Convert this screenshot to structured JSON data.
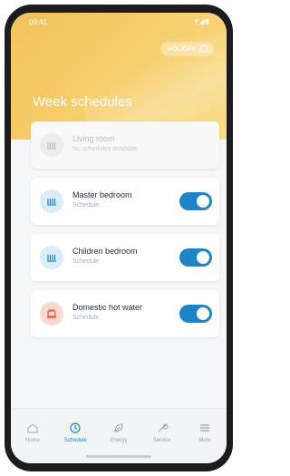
{
  "status_bar": {
    "time": "09:41",
    "icons": "▾◢▮"
  },
  "header": {
    "holiday_label": "HOLIDAY",
    "title": "Week schedules"
  },
  "schedules": [
    {
      "name": "Living room",
      "subtitle": "No schedules available",
      "enabled": false,
      "icon": "radiator-icon"
    },
    {
      "name": "Master bedroom",
      "subtitle": "Schedule",
      "enabled": true,
      "icon": "radiator-icon"
    },
    {
      "name": "Children bedroom",
      "subtitle": "Schedule",
      "enabled": true,
      "icon": "radiator-icon"
    },
    {
      "name": "Domestic hot water",
      "subtitle": "Schedule",
      "enabled": true,
      "icon": "hot-water-icon"
    }
  ],
  "bottom_nav": [
    {
      "label": "Home",
      "icon": "home-icon",
      "active": false
    },
    {
      "label": "Schedule",
      "icon": "clock-icon",
      "active": true
    },
    {
      "label": "Energy",
      "icon": "leaf-icon",
      "active": false
    },
    {
      "label": "Service",
      "icon": "wrench-icon",
      "active": false
    },
    {
      "label": "More",
      "icon": "menu-icon",
      "active": false
    }
  ],
  "colors": {
    "header_gradient_start": "#f3c35b",
    "accent_blue": "#1f84c6",
    "hot_water_bg": "#fbd9cf"
  }
}
